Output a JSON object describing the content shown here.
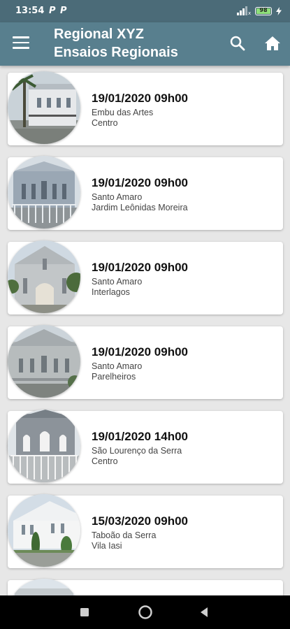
{
  "status_bar": {
    "time": "13:54",
    "notifications": [
      "P",
      "P"
    ],
    "battery_level": "98"
  },
  "app_bar": {
    "title_line1": "Regional XYZ",
    "title_line2": "Ensaios Regionais",
    "icons": [
      "menu-icon",
      "search-icon",
      "home-icon"
    ]
  },
  "events": [
    {
      "datetime": "19/01/2020 09h00",
      "city": "Embu das Artes",
      "area": "Centro"
    },
    {
      "datetime": "19/01/2020 09h00",
      "city": "Santo Amaro",
      "area": "Jardim Leônidas Moreira"
    },
    {
      "datetime": "19/01/2020 09h00",
      "city": "Santo Amaro",
      "area": "Interlagos"
    },
    {
      "datetime": "19/01/2020 09h00",
      "city": "Santo Amaro",
      "area": "Parelheiros"
    },
    {
      "datetime": "19/01/2020 14h00",
      "city": "São Lourenço da Serra",
      "area": "Centro"
    },
    {
      "datetime": "15/03/2020 09h00",
      "city": "Taboão da Serra",
      "area": "Vila Iasi"
    }
  ],
  "colors": {
    "status_bar": "#4b6b78",
    "app_bar": "#587f8e",
    "background": "#e7e7e7",
    "card": "#ffffff"
  }
}
